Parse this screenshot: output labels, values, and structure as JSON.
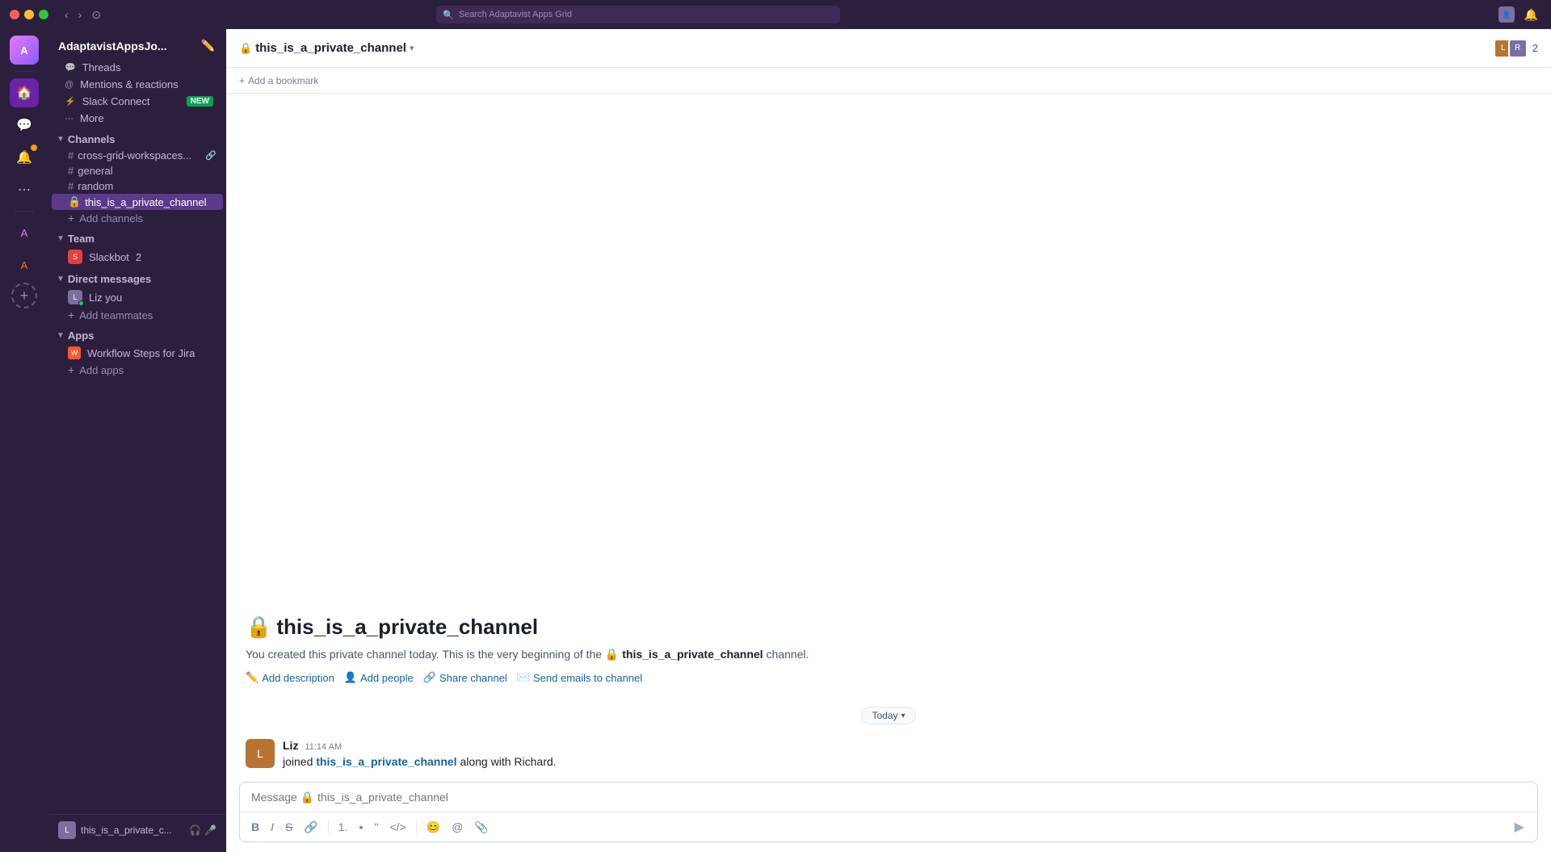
{
  "titleBar": {
    "searchPlaceholder": "Search Adaptavist Apps Grid",
    "back": "‹",
    "forward": "›",
    "history": "⊙"
  },
  "workspace": {
    "name": "AdaptavistAppsJo...",
    "avatarText": "A"
  },
  "sidebar": {
    "threads": "Threads",
    "mentions": "Mentions & reactions",
    "slackConnect": "Slack Connect",
    "slackConnectBadge": "NEW",
    "more": "More",
    "channels": {
      "label": "Channels",
      "items": [
        {
          "name": "cross-grid-workspaces...",
          "icons": "🔗"
        },
        {
          "name": "general"
        },
        {
          "name": "random"
        },
        {
          "name": "this_is_a_private_channel",
          "active": true
        }
      ],
      "addLabel": "Add channels"
    },
    "team": {
      "label": "Team",
      "items": [
        {
          "name": "Slackbot",
          "badge": "2"
        }
      ]
    },
    "directMessages": {
      "label": "Direct messages",
      "items": [
        {
          "name": "Liz  you"
        }
      ],
      "addLabel": "Add teammates"
    },
    "apps": {
      "label": "Apps",
      "items": [
        {
          "name": "Workflow Steps for Jira"
        }
      ],
      "addLabel": "Add apps"
    }
  },
  "channel": {
    "name": "this_is_a_private_channel",
    "memberCount": "2",
    "bookmarkLabel": "Add a bookmark",
    "introTitle": "this_is_a_private_channel",
    "introText": "You created this private channel today. This is the very beginning of the",
    "introChannelRef": "this_is_a_private_channel",
    "introSuffix": "channel.",
    "links": {
      "addDescription": "Add description",
      "addPeople": "Add people",
      "shareChannel": "Share channel",
      "sendEmails": "Send emails to channel"
    }
  },
  "messages": {
    "dateDivider": "Today",
    "items": [
      {
        "author": "Liz",
        "time": "11:14 AM",
        "text": "joined this_is_a_private_channel along with Richard.",
        "avatarText": "L",
        "avatarColor": "#b87333"
      }
    ]
  },
  "compose": {
    "placeholder": "Message 🔒 this_is_a_private_channel"
  },
  "footer": {
    "channelName": "this_is_a_private_c...",
    "avatarText": "L"
  }
}
